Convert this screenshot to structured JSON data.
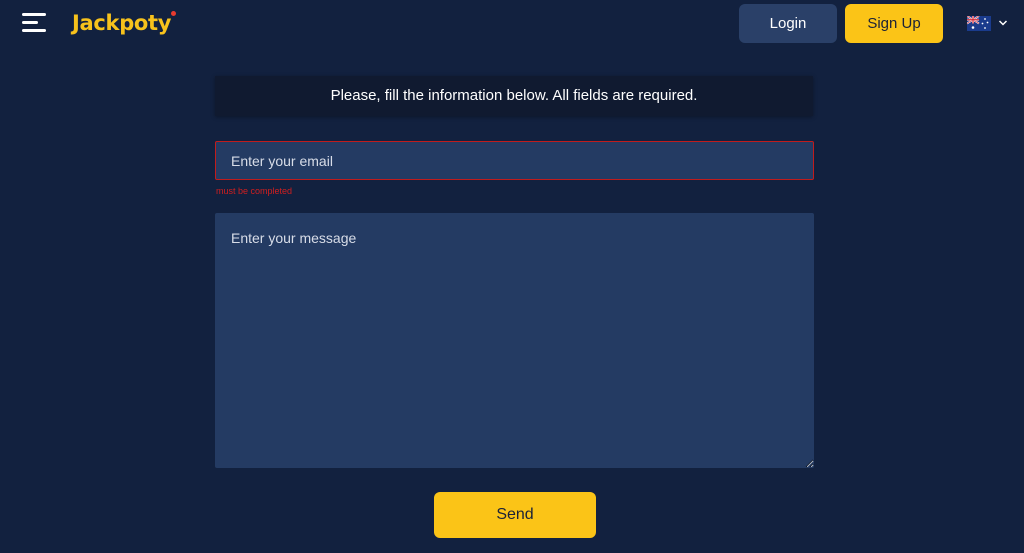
{
  "header": {
    "menu_icon": "hamburger-menu-icon",
    "logo_text": "Jackpoty",
    "login_label": "Login",
    "signup_label": "Sign Up",
    "language_icon": "flag-australia-icon"
  },
  "form": {
    "notice": "Please, fill the information below. All fields are required.",
    "email_placeholder": "Enter your email",
    "email_error": "must be completed",
    "message_placeholder": "Enter your message",
    "send_label": "Send"
  },
  "colors": {
    "background": "#12213f",
    "accent_yellow": "#fbc417",
    "field_bg": "#243b63",
    "error_red": "#c11c1c",
    "login_bg": "#2a4068"
  }
}
